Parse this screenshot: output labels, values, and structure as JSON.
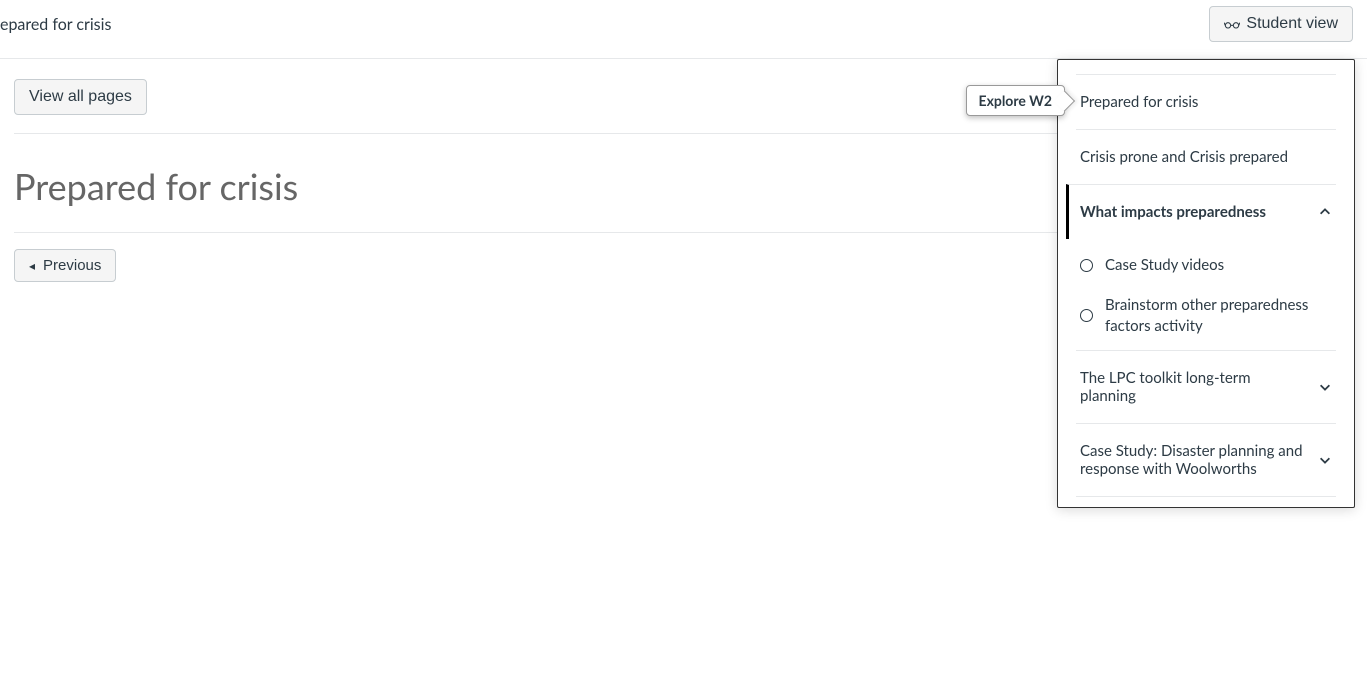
{
  "header": {
    "breadcrumb_fragment": "epared for crisis",
    "student_view_label": "Student view"
  },
  "toolbar": {
    "view_all_pages_label": "View all pages"
  },
  "page": {
    "title": "Prepared for crisis"
  },
  "explore": {
    "tag_label": "Explore W2",
    "items": [
      {
        "label": "Prepared for crisis",
        "expandable": false,
        "current": false
      },
      {
        "label": "Crisis prone and Crisis prepared",
        "expandable": false,
        "current": false
      },
      {
        "label": "What impacts preparedness",
        "expandable": true,
        "expanded": true,
        "current": true,
        "children": [
          {
            "label": "Case Study videos"
          },
          {
            "label": "Brainstorm other preparedness factors activity"
          }
        ]
      },
      {
        "label": "The LPC toolkit long-term planning",
        "expandable": true,
        "expanded": false,
        "current": false
      },
      {
        "label": "Case Study: Disaster planning and response with Woolworths",
        "expandable": true,
        "expanded": false,
        "current": false
      }
    ]
  },
  "nav": {
    "previous_label": "Previous"
  }
}
